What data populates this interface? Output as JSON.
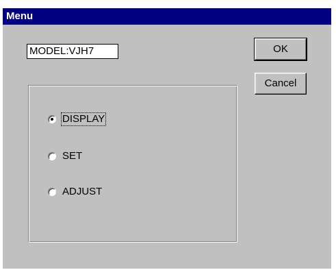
{
  "window": {
    "title": "Menu"
  },
  "model_field": {
    "value": "MODEL:VJH7"
  },
  "buttons": {
    "ok_label": "OK",
    "cancel_label": "Cancel"
  },
  "options": [
    {
      "label": "DISPLAY",
      "selected": true
    },
    {
      "label": "SET",
      "selected": false
    },
    {
      "label": "ADJUST",
      "selected": false
    }
  ],
  "colors": {
    "titlebar": "#000080",
    "face": "#c0c0c0"
  }
}
